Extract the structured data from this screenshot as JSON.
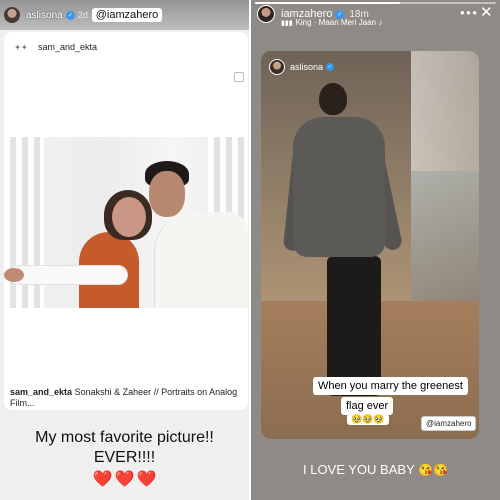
{
  "left_story": {
    "username": "aslisona",
    "time": "2d",
    "mention": "@iamzahero",
    "post": {
      "account": "sam_and_ekta",
      "caption_account": "sam_and_ekta",
      "caption_text": "Sonakshi & Zaheer // Portraits on Analog Film..."
    },
    "overlay_line1": "My most favorite picture!!",
    "overlay_line2": "EVER!!!!",
    "hearts": [
      "❤️",
      "❤️",
      "❤️"
    ]
  },
  "right_story": {
    "username": "iamzahero",
    "time": "18m",
    "music": "King · Maan Meri Jaan ♪",
    "video_username": "aslisona",
    "caption_line1": "When you marry the greenest",
    "caption_line2": "flag ever",
    "caption_emojis": "🥹🥹🥹",
    "mention": "@iamzahero",
    "bottom_text": "I LOVE YOU BABY",
    "bottom_emojis": "😘😘"
  },
  "icons": {
    "verified": "verified-badge-icon",
    "more": "more-options-icon",
    "close": "close-icon",
    "music": "music-bars-icon",
    "heart": "heart-icon"
  }
}
